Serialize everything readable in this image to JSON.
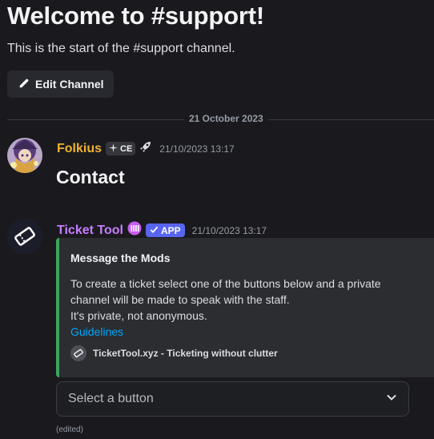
{
  "channel_intro": {
    "title": "Welcome to #support!",
    "subtitle": "This is the start of the #support channel.",
    "edit_button_label": "Edit Channel"
  },
  "date_divider": "21 October 2023",
  "messages": [
    {
      "author": "Folkius",
      "author_color": "#f0b232",
      "tag": "CE",
      "timestamp": "21/10/2023 13:17",
      "content": "Contact"
    },
    {
      "author": "Ticket Tool",
      "author_color": "#c77dff",
      "badge": "APP",
      "timestamp": "21/10/2023 13:17",
      "embed": {
        "accent_color": "#3ba55c",
        "title": "Message the Mods",
        "description_lines": [
          "To create a ticket select one of the buttons below and a private",
          "channel will be made to speak with the staff.",
          "It's private, not anonymous."
        ],
        "link_text": "Guidelines",
        "footer_text": "TicketTool.xyz - Ticketing without clutter"
      },
      "select_placeholder": "Select a button",
      "edited_label": "(edited)"
    }
  ],
  "icons": {
    "edit": "pencil-icon",
    "tag": "sparkle-icon",
    "rocket": "rocket-icon",
    "bot_avatar": "ticket-icon",
    "nitro_badge": "server-badge-icon",
    "check": "check-icon",
    "chevron": "chevron-down-icon"
  }
}
